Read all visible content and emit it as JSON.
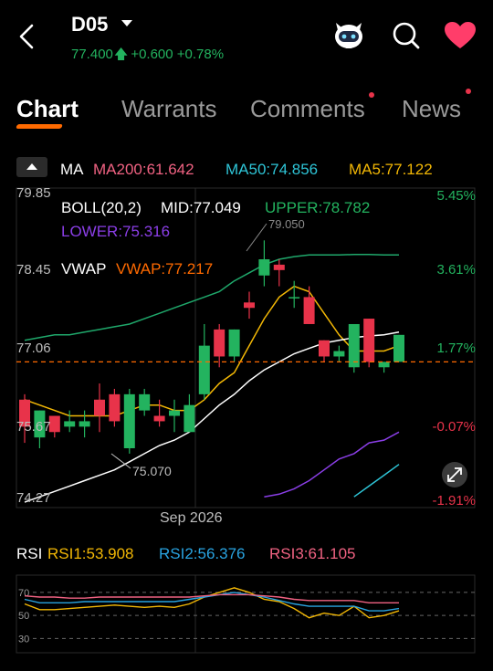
{
  "header": {
    "ticker": "D05",
    "price": "77.400",
    "change": "+0.600",
    "change_pct": "+0.78%",
    "up_color": "#23b35f",
    "icons": [
      "back-icon",
      "dropdown-caret-icon",
      "robot-assistant-icon",
      "search-icon",
      "heart-icon"
    ]
  },
  "tabs": [
    {
      "label": "Chart",
      "active": true
    },
    {
      "label": "Warrants",
      "active": false
    },
    {
      "label": "Comments",
      "active": false,
      "badge": true
    },
    {
      "label": "News",
      "active": false,
      "badge": true
    }
  ],
  "ma_row": {
    "ma": "MA",
    "ma200": "MA200:61.642",
    "ma50": "MA50:74.856",
    "ma5": "MA5:77.122"
  },
  "overlay": {
    "boll": "BOLL(20,2)",
    "mid": "MID:77.049",
    "upper": "UPPER:78.782",
    "lower": "LOWER:75.316",
    "vwap_label": "VWAP",
    "vwap": "VWAP:77.217",
    "high_marker": "79.050",
    "low_marker": "75.070",
    "date_label": "Sep 2026",
    "price_ticks": [
      "79.85",
      "78.45",
      "77.06",
      "75.67",
      "74.27"
    ],
    "pct_ticks": [
      "5.45%",
      "3.61%",
      "1.77%",
      "-0.07%",
      "-1.91%"
    ],
    "expand_icon": "expand-icon"
  },
  "chart_data": {
    "type": "candlestick",
    "x_label": "Sep 2026",
    "ylim": [
      74.27,
      79.85
    ],
    "reference_price": 76.8,
    "candles": [
      {
        "o": 76.1,
        "h": 76.2,
        "l": 75.3,
        "c": 75.6
      },
      {
        "o": 75.4,
        "h": 75.9,
        "l": 75.2,
        "c": 75.9
      },
      {
        "o": 75.8,
        "h": 75.8,
        "l": 75.4,
        "c": 75.5
      },
      {
        "o": 75.6,
        "h": 75.9,
        "l": 75.5,
        "c": 75.7
      },
      {
        "o": 75.6,
        "h": 75.9,
        "l": 75.4,
        "c": 75.7
      },
      {
        "o": 76.1,
        "h": 76.4,
        "l": 75.5,
        "c": 75.8
      },
      {
        "o": 76.2,
        "h": 76.3,
        "l": 75.6,
        "c": 75.7
      },
      {
        "o": 75.2,
        "h": 76.3,
        "l": 75.1,
        "c": 76.2
      },
      {
        "o": 75.9,
        "h": 76.3,
        "l": 75.8,
        "c": 76.2
      },
      {
        "o": 75.8,
        "h": 76.1,
        "l": 75.6,
        "c": 75.7
      },
      {
        "o": 75.8,
        "h": 76.1,
        "l": 75.5,
        "c": 75.9
      },
      {
        "o": 75.5,
        "h": 76.2,
        "l": 75.5,
        "c": 76.0
      },
      {
        "o": 76.2,
        "h": 77.5,
        "l": 76.1,
        "c": 77.1
      },
      {
        "o": 77.4,
        "h": 77.5,
        "l": 76.7,
        "c": 76.9
      },
      {
        "o": 76.9,
        "h": 77.4,
        "l": 76.8,
        "c": 77.4
      },
      {
        "o": 77.9,
        "h": 78.1,
        "l": 77.6,
        "c": 77.8
      },
      {
        "o": 78.4,
        "h": 79.05,
        "l": 78.2,
        "c": 78.7
      },
      {
        "o": 78.6,
        "h": 78.7,
        "l": 78.2,
        "c": 78.5
      },
      {
        "o": 78.0,
        "h": 78.3,
        "l": 77.8,
        "c": 78.0
      },
      {
        "o": 78.0,
        "h": 78.2,
        "l": 77.5,
        "c": 77.5
      },
      {
        "o": 77.2,
        "h": 77.2,
        "l": 76.8,
        "c": 76.9
      },
      {
        "o": 76.9,
        "h": 77.1,
        "l": 76.8,
        "c": 77.0
      },
      {
        "o": 76.7,
        "h": 77.4,
        "l": 76.6,
        "c": 77.5
      },
      {
        "o": 77.6,
        "h": 77.6,
        "l": 76.7,
        "c": 76.8
      },
      {
        "o": 76.7,
        "h": 76.8,
        "l": 76.6,
        "c": 76.8
      },
      {
        "o": 76.8,
        "h": 77.3,
        "l": 76.8,
        "c": 77.3
      }
    ],
    "series": [
      {
        "name": "UPPER",
        "color": "#1fa86b",
        "values": [
          77.2,
          77.25,
          77.3,
          77.3,
          77.35,
          77.4,
          77.45,
          77.5,
          77.6,
          77.7,
          77.8,
          77.9,
          78.0,
          78.1,
          78.3,
          78.45,
          78.6,
          78.7,
          78.75,
          78.78,
          78.78,
          78.78,
          78.79,
          78.79,
          78.78,
          78.78
        ]
      },
      {
        "name": "MA5",
        "color": "#f2b705",
        "values": [
          76.1,
          76.0,
          75.9,
          75.8,
          75.8,
          75.8,
          75.8,
          75.9,
          76.0,
          76.0,
          75.9,
          75.9,
          76.1,
          76.4,
          76.6,
          77.1,
          77.6,
          78.0,
          78.2,
          78.1,
          77.7,
          77.3,
          77.0,
          77.0,
          77.0,
          77.1
        ]
      },
      {
        "name": "VWAP",
        "color": "#ffffff",
        "values": [
          74.2,
          74.3,
          74.4,
          74.5,
          74.6,
          74.7,
          74.8,
          74.95,
          75.1,
          75.25,
          75.35,
          75.5,
          75.75,
          76.0,
          76.2,
          76.45,
          76.65,
          76.8,
          76.95,
          77.05,
          77.15,
          77.2,
          77.25,
          77.28,
          77.3,
          77.35
        ]
      },
      {
        "name": "LOWER",
        "color": "#8a3ee6",
        "values": [
          null,
          null,
          null,
          null,
          null,
          null,
          null,
          null,
          null,
          null,
          null,
          null,
          null,
          null,
          null,
          null,
          74.3,
          74.35,
          74.45,
          74.6,
          74.8,
          75.0,
          75.1,
          75.3,
          75.35,
          75.5
        ]
      },
      {
        "name": "MA50",
        "color": "#2ec4d6",
        "values": [
          null,
          null,
          null,
          null,
          null,
          null,
          null,
          null,
          null,
          null,
          null,
          null,
          null,
          null,
          null,
          null,
          null,
          null,
          null,
          null,
          null,
          null,
          74.3,
          74.5,
          74.7,
          74.9
        ]
      }
    ]
  },
  "rsi": {
    "label": "RSI",
    "rsi1": "RSI1:53.908",
    "rsi2": "RSI2:56.376",
    "rsi3": "RSI3:61.105",
    "levels": [
      "70",
      "50",
      "30"
    ],
    "chart_data": {
      "type": "line",
      "ylim": [
        20,
        85
      ],
      "series": [
        {
          "name": "RSI1",
          "color": "#f2b705",
          "values": [
            60,
            55,
            55,
            56,
            57,
            58,
            59,
            58,
            57,
            58,
            57,
            60,
            66,
            70,
            74,
            70,
            64,
            62,
            56,
            48,
            52,
            50,
            58,
            48,
            50,
            54
          ]
        },
        {
          "name": "RSI2",
          "color": "#29a3e0",
          "values": [
            64,
            61,
            61,
            61,
            62,
            62,
            62,
            62,
            62,
            62,
            62,
            64,
            66,
            68,
            70,
            68,
            66,
            63,
            60,
            58,
            58,
            58,
            58,
            54,
            54,
            56
          ]
        },
        {
          "name": "RSI3",
          "color": "#f06282",
          "values": [
            67,
            66,
            66,
            65,
            65,
            66,
            66,
            66,
            66,
            66,
            66,
            66,
            67,
            68,
            68,
            68,
            67,
            66,
            64,
            63,
            63,
            63,
            63,
            61,
            61,
            61
          ]
        }
      ]
    }
  }
}
